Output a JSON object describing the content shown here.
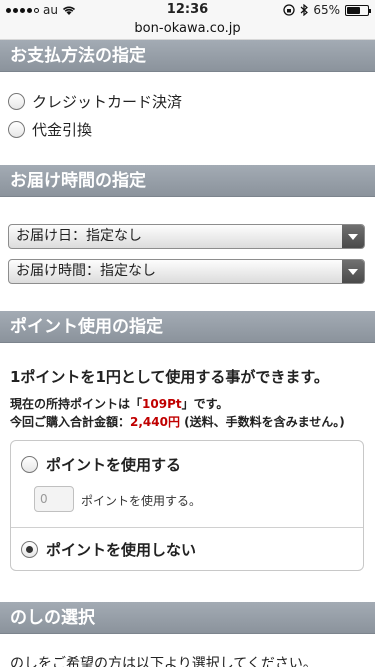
{
  "status_bar": {
    "carrier": "au",
    "time": "12:36",
    "battery": "65%",
    "battery_level": 0.65
  },
  "url_bar": {
    "url": "bon-okawa.co.jp"
  },
  "payment": {
    "title": "お支払方法の指定",
    "options": [
      {
        "label": "クレジットカード決済",
        "selected": false
      },
      {
        "label": "代金引換",
        "selected": false
      }
    ]
  },
  "delivery": {
    "title": "お届け時間の指定",
    "date_select": "お届け日：指定なし",
    "time_select": "お届け時間：指定なし"
  },
  "points": {
    "title": "ポイント使用の指定",
    "intro": "1ポイントを1円として使用する事ができます。",
    "current_prefix": "現在の所持ポイントは「",
    "current_value": "109Pt",
    "current_suffix": "」です。",
    "total_prefix": "今回ご購入合計金額：",
    "total_value": "2,440円",
    "total_suffix": " (送料、手数料を含みません。)",
    "use_label": "ポイントを使用する",
    "input_placeholder": "0",
    "input_suffix": "ポイントを使用する。",
    "no_use_label": "ポイントを使用しない"
  },
  "noshi": {
    "title": "のしの選択",
    "text": "のしをご希望の方は以下より選択してください。"
  }
}
